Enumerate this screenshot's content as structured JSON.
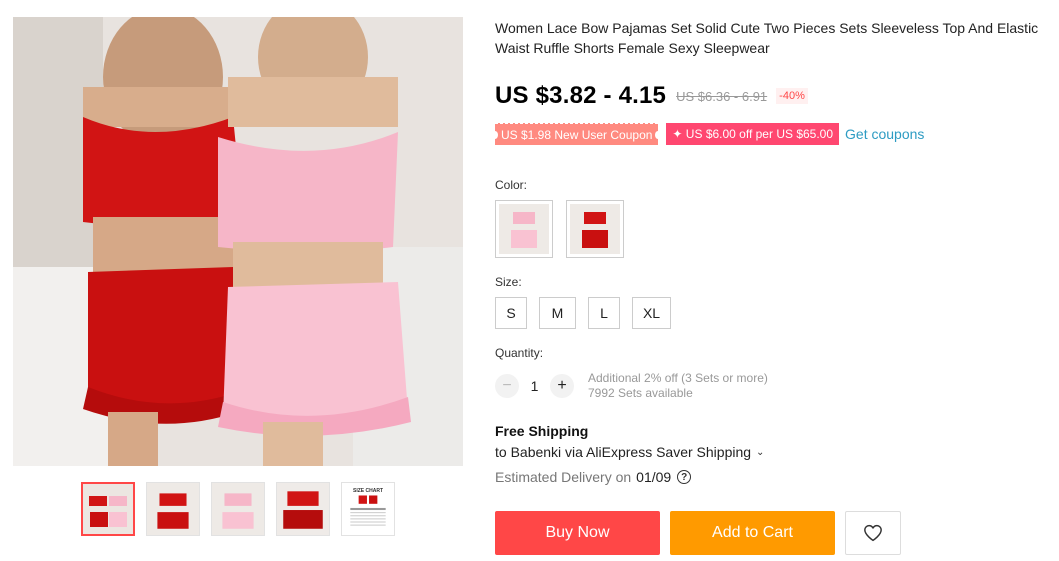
{
  "product": {
    "title": "Women Lace Bow Pajamas Set Solid Cute Two Pieces Sets Sleeveless Top And Elastic Waist Ruffle Shorts Female Sexy Sleepwear",
    "price": "US $3.82 - 4.15",
    "original_price": "US $6.36 - 6.91",
    "discount": "-40%"
  },
  "coupons": {
    "new_user": "US $1.98 New User Coupon",
    "store": "✦ US $6.00 off per US $65.00",
    "get_link": "Get coupons"
  },
  "color": {
    "label": "Color:",
    "options": [
      "pink",
      "red"
    ]
  },
  "size": {
    "label": "Size:",
    "options": [
      "S",
      "M",
      "L",
      "XL"
    ]
  },
  "quantity": {
    "label": "Quantity:",
    "value": "1",
    "minus": "−",
    "plus": "+",
    "bulk_offer": "Additional 2% off (3 Sets or more)",
    "available": "7992 Sets available"
  },
  "shipping": {
    "title": "Free Shipping",
    "detail": "to Babenki via AliExpress Saver Shipping",
    "delivery_label": "Estimated Delivery on",
    "delivery_date": "01/09",
    "help": "?"
  },
  "actions": {
    "buy_now": "Buy Now",
    "add_to_cart": "Add to Cart"
  },
  "gallery": {
    "thumbnails": [
      "red-pink-front",
      "red-set",
      "pink-set",
      "red-set-back",
      "size-chart"
    ],
    "size_chart_title": "SIZE CHART"
  },
  "colors": {
    "accent_red": "#ff4747",
    "cart_orange": "#ff9a00",
    "coupon_pink": "#ff4770",
    "link_blue": "#2e9cc3"
  }
}
